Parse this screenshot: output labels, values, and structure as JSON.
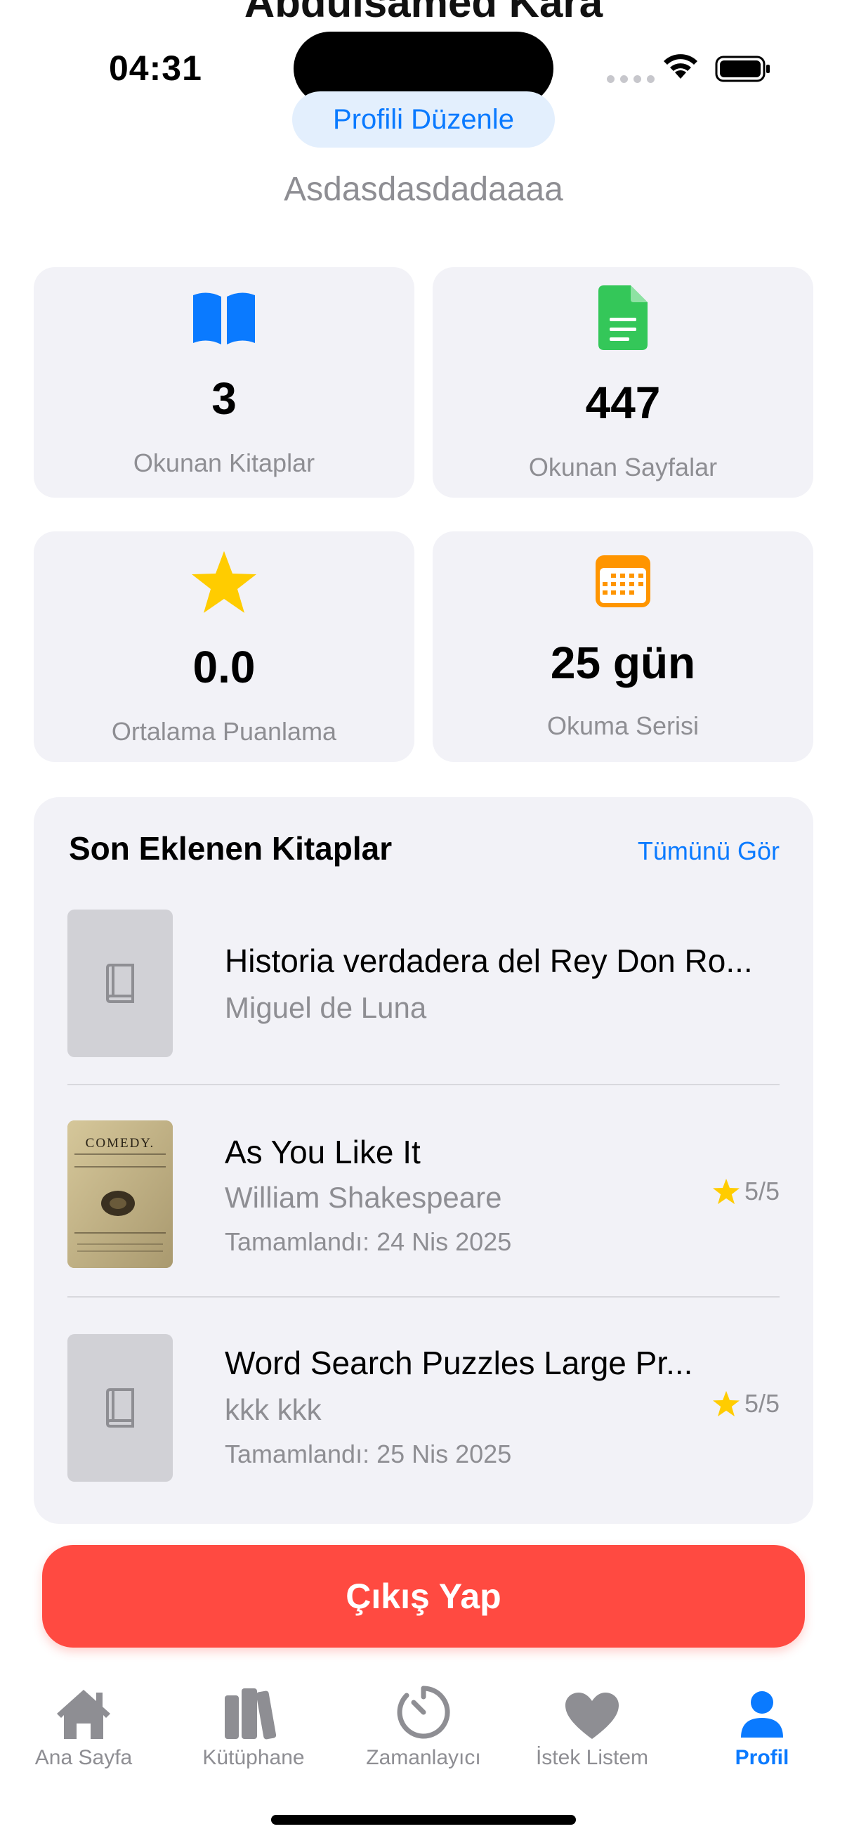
{
  "profile": {
    "name": "Abdulsamed Kara",
    "edit_label": "Profili Düzenle",
    "bio": "Asdasdasdadaaaa"
  },
  "status_bar": {
    "time": "04:31"
  },
  "stats": [
    {
      "value": "3",
      "label": "Okunan Kitaplar",
      "icon": "book-open-icon",
      "color": "#0a7aff"
    },
    {
      "value": "447",
      "label": "Okunan Sayfalar",
      "icon": "document-icon",
      "color": "#34c759"
    },
    {
      "value": "0.0",
      "label": "Ortalama Puanlama",
      "icon": "star-icon",
      "color": "#ffcc00"
    },
    {
      "value": "25 gün",
      "label": "Okuma Serisi",
      "icon": "calendar-icon",
      "color": "#ff9500"
    }
  ],
  "recent": {
    "title": "Son Eklenen Kitaplar",
    "see_all": "Tümünü Gör",
    "books": [
      {
        "title": "Historia verdadera del Rey Don Ro...",
        "author": "Miguel de Luna",
        "date": "",
        "rating": ""
      },
      {
        "title": "As You Like It",
        "author": "William Shakespeare",
        "date": "Tamamlandı: 24 Nis 2025",
        "rating": "5/5",
        "cover_text": "COMEDY."
      },
      {
        "title": "Word Search Puzzles Large Pr...",
        "author": "kkk kkk",
        "date": "Tamamlandı: 25 Nis 2025",
        "rating": "5/5"
      }
    ]
  },
  "logout_label": "Çıkış Yap",
  "tabs": [
    {
      "label": "Ana Sayfa",
      "icon": "house-icon"
    },
    {
      "label": "Kütüphane",
      "icon": "books-icon"
    },
    {
      "label": "Zamanlayıcı",
      "icon": "timer-icon"
    },
    {
      "label": "İstek Listem",
      "icon": "heart-icon"
    },
    {
      "label": "Profil",
      "icon": "person-icon",
      "active": true
    }
  ],
  "colors": {
    "accent": "#0a7aff",
    "danger": "#ff4a41",
    "card": "#f2f2f7",
    "muted": "#8e8e93"
  }
}
